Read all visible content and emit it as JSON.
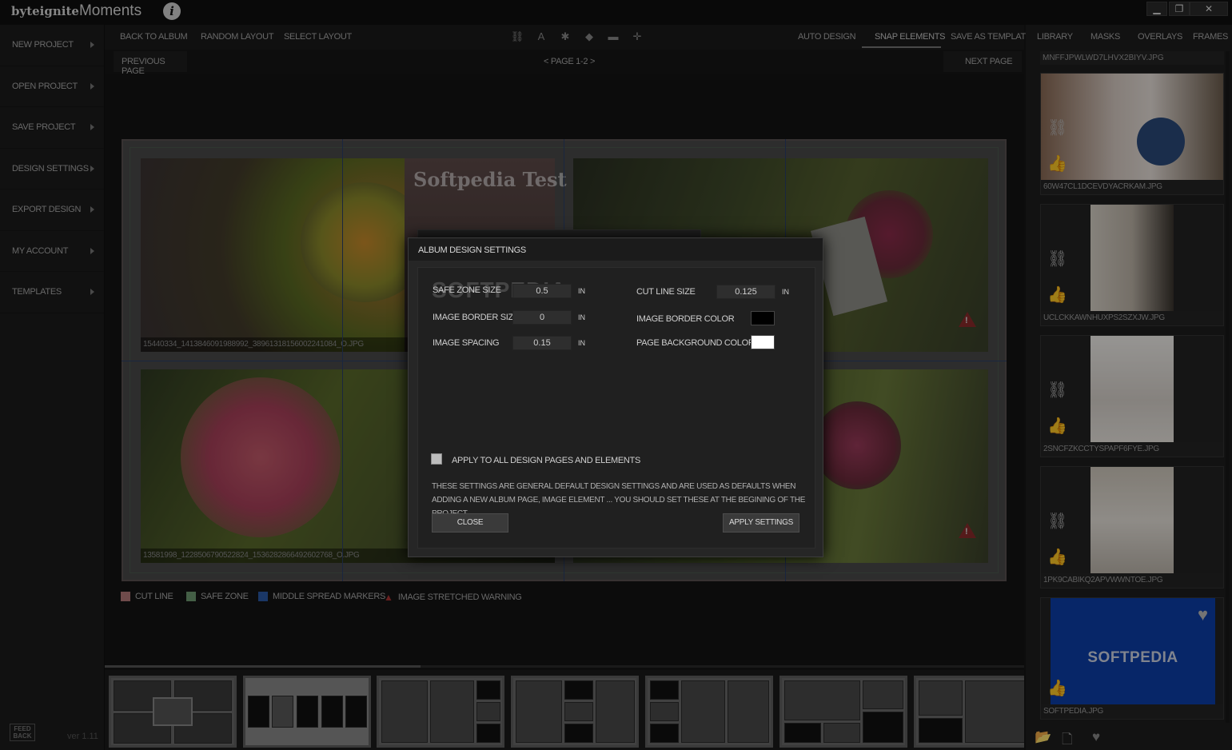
{
  "app": {
    "logo_bold": "byteignite",
    "logo_light": "Moments",
    "info_icon": "i",
    "window_buttons": [
      "▁",
      "❐",
      "✕"
    ],
    "version": "ver 1.11",
    "feedback": "FEED BACK"
  },
  "sidebar": {
    "items": [
      {
        "label": "NEW PROJECT"
      },
      {
        "label": "OPEN PROJECT"
      },
      {
        "label": "SAVE PROJECT"
      },
      {
        "label": "DESIGN SETTINGS"
      },
      {
        "label": "EXPORT DESIGN"
      },
      {
        "label": "MY ACCOUNT"
      },
      {
        "label": "TEMPLATES"
      }
    ]
  },
  "toolbar": {
    "back_to_album": "BACK TO ALBUM",
    "random_layout": "RANDOM LAYOUT",
    "select_layout": "SELECT LAYOUT",
    "auto_design": "AUTO DESIGN",
    "snap_elements": "SNAP ELEMENTS",
    "save_as_template": "SAVE AS TEMPLATE",
    "tool_icons": [
      "link-icon",
      "text-size-icon",
      "bug-icon",
      "layer-up-icon",
      "layer-down-icon",
      "crosshair-icon"
    ]
  },
  "pagebar": {
    "previous": "PREVIOUS PAGE",
    "current": "< PAGE 1-2 >",
    "next": "NEXT PAGE"
  },
  "canvas": {
    "watermark_text": "Softpedia Test",
    "photo_captions": [
      "15440334_1413846091988992_3896131815600224108​4_O.JPG",
      "13581998_1228506790522824_1536282866492602768_O.JPG"
    ],
    "warning_icon": "!"
  },
  "legend": {
    "items": [
      {
        "label": "CUT LINE",
        "color": "#b47a7a"
      },
      {
        "label": "SAFE ZONE",
        "color": "#6f9a72"
      },
      {
        "label": "MIDDLE SPREAD MARKERS",
        "color": "#2a5aa5"
      },
      {
        "label": "IMAGE STRETCHED WARNING",
        "color": "#a33"
      }
    ]
  },
  "right_panel": {
    "tabs": [
      "LIBRARY",
      "MASKS",
      "OVERLAYS",
      "FRAMES"
    ],
    "first_label": "MNFFJPWLWD7LHVX2BIYV.JPG",
    "items": [
      {
        "label": "60W47CL1DCEVDYACRKAM.JPG"
      },
      {
        "label": "UCLCKKAWNHUXPS2SZXJW.JPG"
      },
      {
        "label": "2SNCFZKCCTYSPAPF6FYE.JPG"
      },
      {
        "label": "1PK9CABIKQ2APVWWNTOE.JPG"
      },
      {
        "label": "SOFTPEDIA.JPG",
        "thumb_text": "SOFTPEDIA"
      }
    ]
  },
  "dialog": {
    "title": "ALBUM DESIGN SETTINGS",
    "watermark": "SOFTPEDIA",
    "safe_zone_size": {
      "label": "SAFE ZONE SIZE",
      "value": "0.5",
      "unit": "IN"
    },
    "image_border_size": {
      "label": "IMAGE BORDER SIZE",
      "value": "0",
      "unit": "IN"
    },
    "image_spacing": {
      "label": "IMAGE SPACING",
      "value": "0.15",
      "unit": "IN"
    },
    "cut_line_size": {
      "label": "CUT LINE SIZE",
      "value": "0.125",
      "unit": "IN"
    },
    "image_border_color": {
      "label": "IMAGE BORDER COLOR",
      "color": "#000000"
    },
    "page_background_color": {
      "label": "PAGE BACKGROUND COLOR",
      "color": "#ffffff"
    },
    "apply_all_label": "APPLY TO ALL DESIGN PAGES AND ELEMENTS",
    "note": "THESE SETTINGS ARE GENERAL DEFAULT DESIGN SETTINGS AND ARE USED AS DEFAULTS WHEN ADDING A NEW ALBUM PAGE, IMAGE ELEMENT ... YOU SHOULD SET THESE AT THE BEGINING OF THE PROJECT.",
    "close_label": "CLOSE",
    "apply_label": "APPLY SETTINGS"
  }
}
